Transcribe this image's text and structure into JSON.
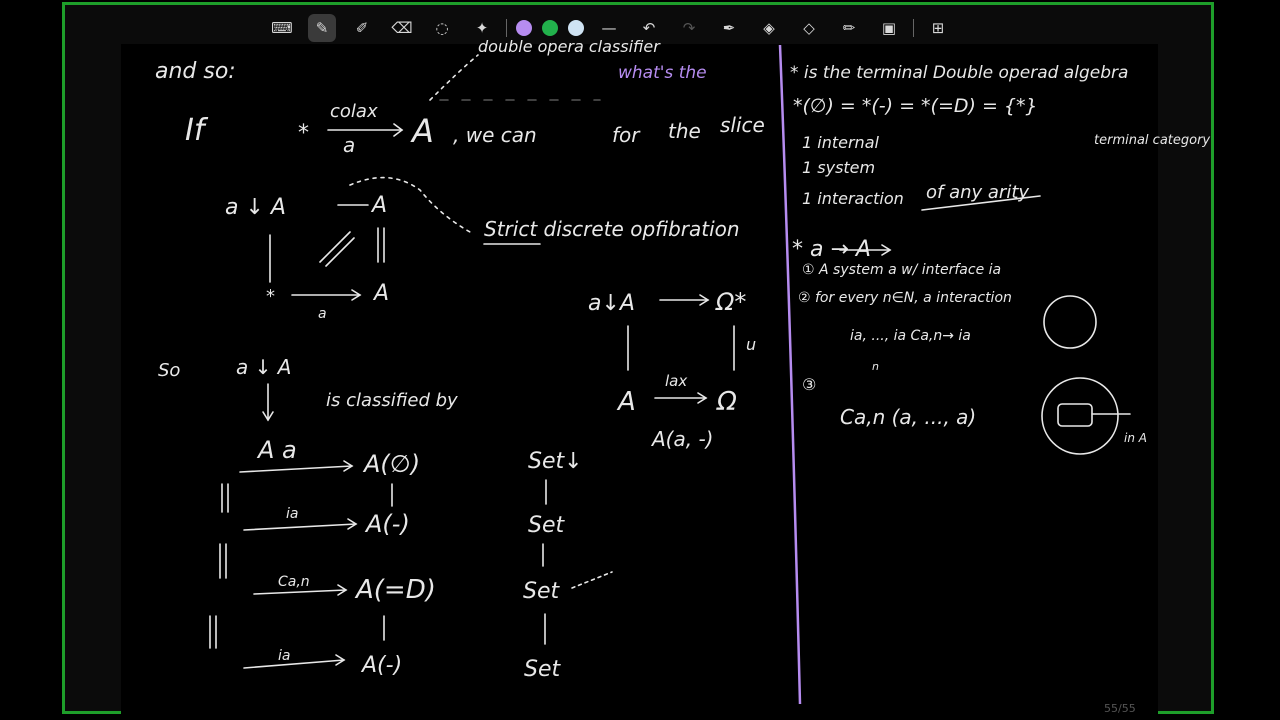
{
  "toolbar": {
    "tools": [
      {
        "name": "keyboard-icon",
        "glyph": "⌨"
      },
      {
        "name": "pen-icon",
        "glyph": "✎"
      },
      {
        "name": "highlighter-icon",
        "glyph": "✐"
      },
      {
        "name": "eraser-icon",
        "glyph": "⌫"
      },
      {
        "name": "lasso-icon",
        "glyph": "◌"
      },
      {
        "name": "magic-wand-icon",
        "glyph": "✦"
      }
    ],
    "colors": [
      "#b68cf0",
      "#22b14c",
      "#cfe3f3"
    ],
    "actions": [
      {
        "name": "line-weight-icon",
        "glyph": "—"
      },
      {
        "name": "undo-icon",
        "glyph": "↶"
      },
      {
        "name": "redo-icon",
        "glyph": "↷"
      },
      {
        "name": "shape-pen-icon",
        "glyph": "✒"
      },
      {
        "name": "fill-icon",
        "glyph": "◈"
      },
      {
        "name": "tag-icon",
        "glyph": "◇"
      },
      {
        "name": "marker-icon",
        "glyph": "✏"
      },
      {
        "name": "clipboard-icon",
        "glyph": "▣"
      },
      {
        "name": "apps-grid-icon",
        "glyph": "⊞"
      }
    ]
  },
  "page_indicator": "55/55",
  "notes": {
    "left": {
      "line_and_so": "and so:",
      "top_fragment_1": "double opera classifier",
      "top_fragment_2": "what's the",
      "if_line": [
        "If",
        "colax",
        "a",
        "A",
        ", we can",
        "for",
        "the",
        "slice"
      ],
      "slice_a": "a ↓ A",
      "slice_arrow_target": "A",
      "slice_star": "*",
      "slice_bottom_a": "a",
      "slice_bottom_A": "A",
      "strict_text": "Strict discrete opfibration",
      "so_line": "So",
      "so_a": "a ↓ A",
      "classified_by": "is classified by",
      "square_top_left": "a↓A",
      "square_top_right": "Ω*",
      "square_u": "u",
      "square_bottom_left": "A",
      "square_lax": "lax",
      "square_bottom_right": "Ω",
      "square_caption": "A(a, -)",
      "A_a": "A a",
      "A_empty": "A(∅)",
      "A_dash": "A(-)",
      "A_multi": "A(=D)",
      "A_dash2": "A(-)",
      "label_ia": "ia",
      "label_cam": "Ca,n",
      "label_ia2": "ia",
      "set_dagger": "Set↓",
      "set_1": "Set",
      "set_2": "Set",
      "set_3": "Set"
    },
    "right": {
      "line1": "* is the terminal Double operad algebra",
      "line2": "*(∅) = *(-) = *(=D) = {*}",
      "terminal_note": "terminal category",
      "list_1": "1  internal",
      "list_2": "1  system",
      "list_3": "1  interaction",
      "list_3_tail": "of any arity",
      "star_arrow": "*  a → A",
      "item_1": "① A system a w/ interface ia",
      "item_2": "② for every n∈N, a interaction",
      "item_2_formula": "ia, ..., ia  Ca,n→ ia",
      "item_2_n": "n",
      "item_3": "③",
      "cam_line": "Ca,n (a, ..., a)",
      "in_A": "in A"
    }
  }
}
